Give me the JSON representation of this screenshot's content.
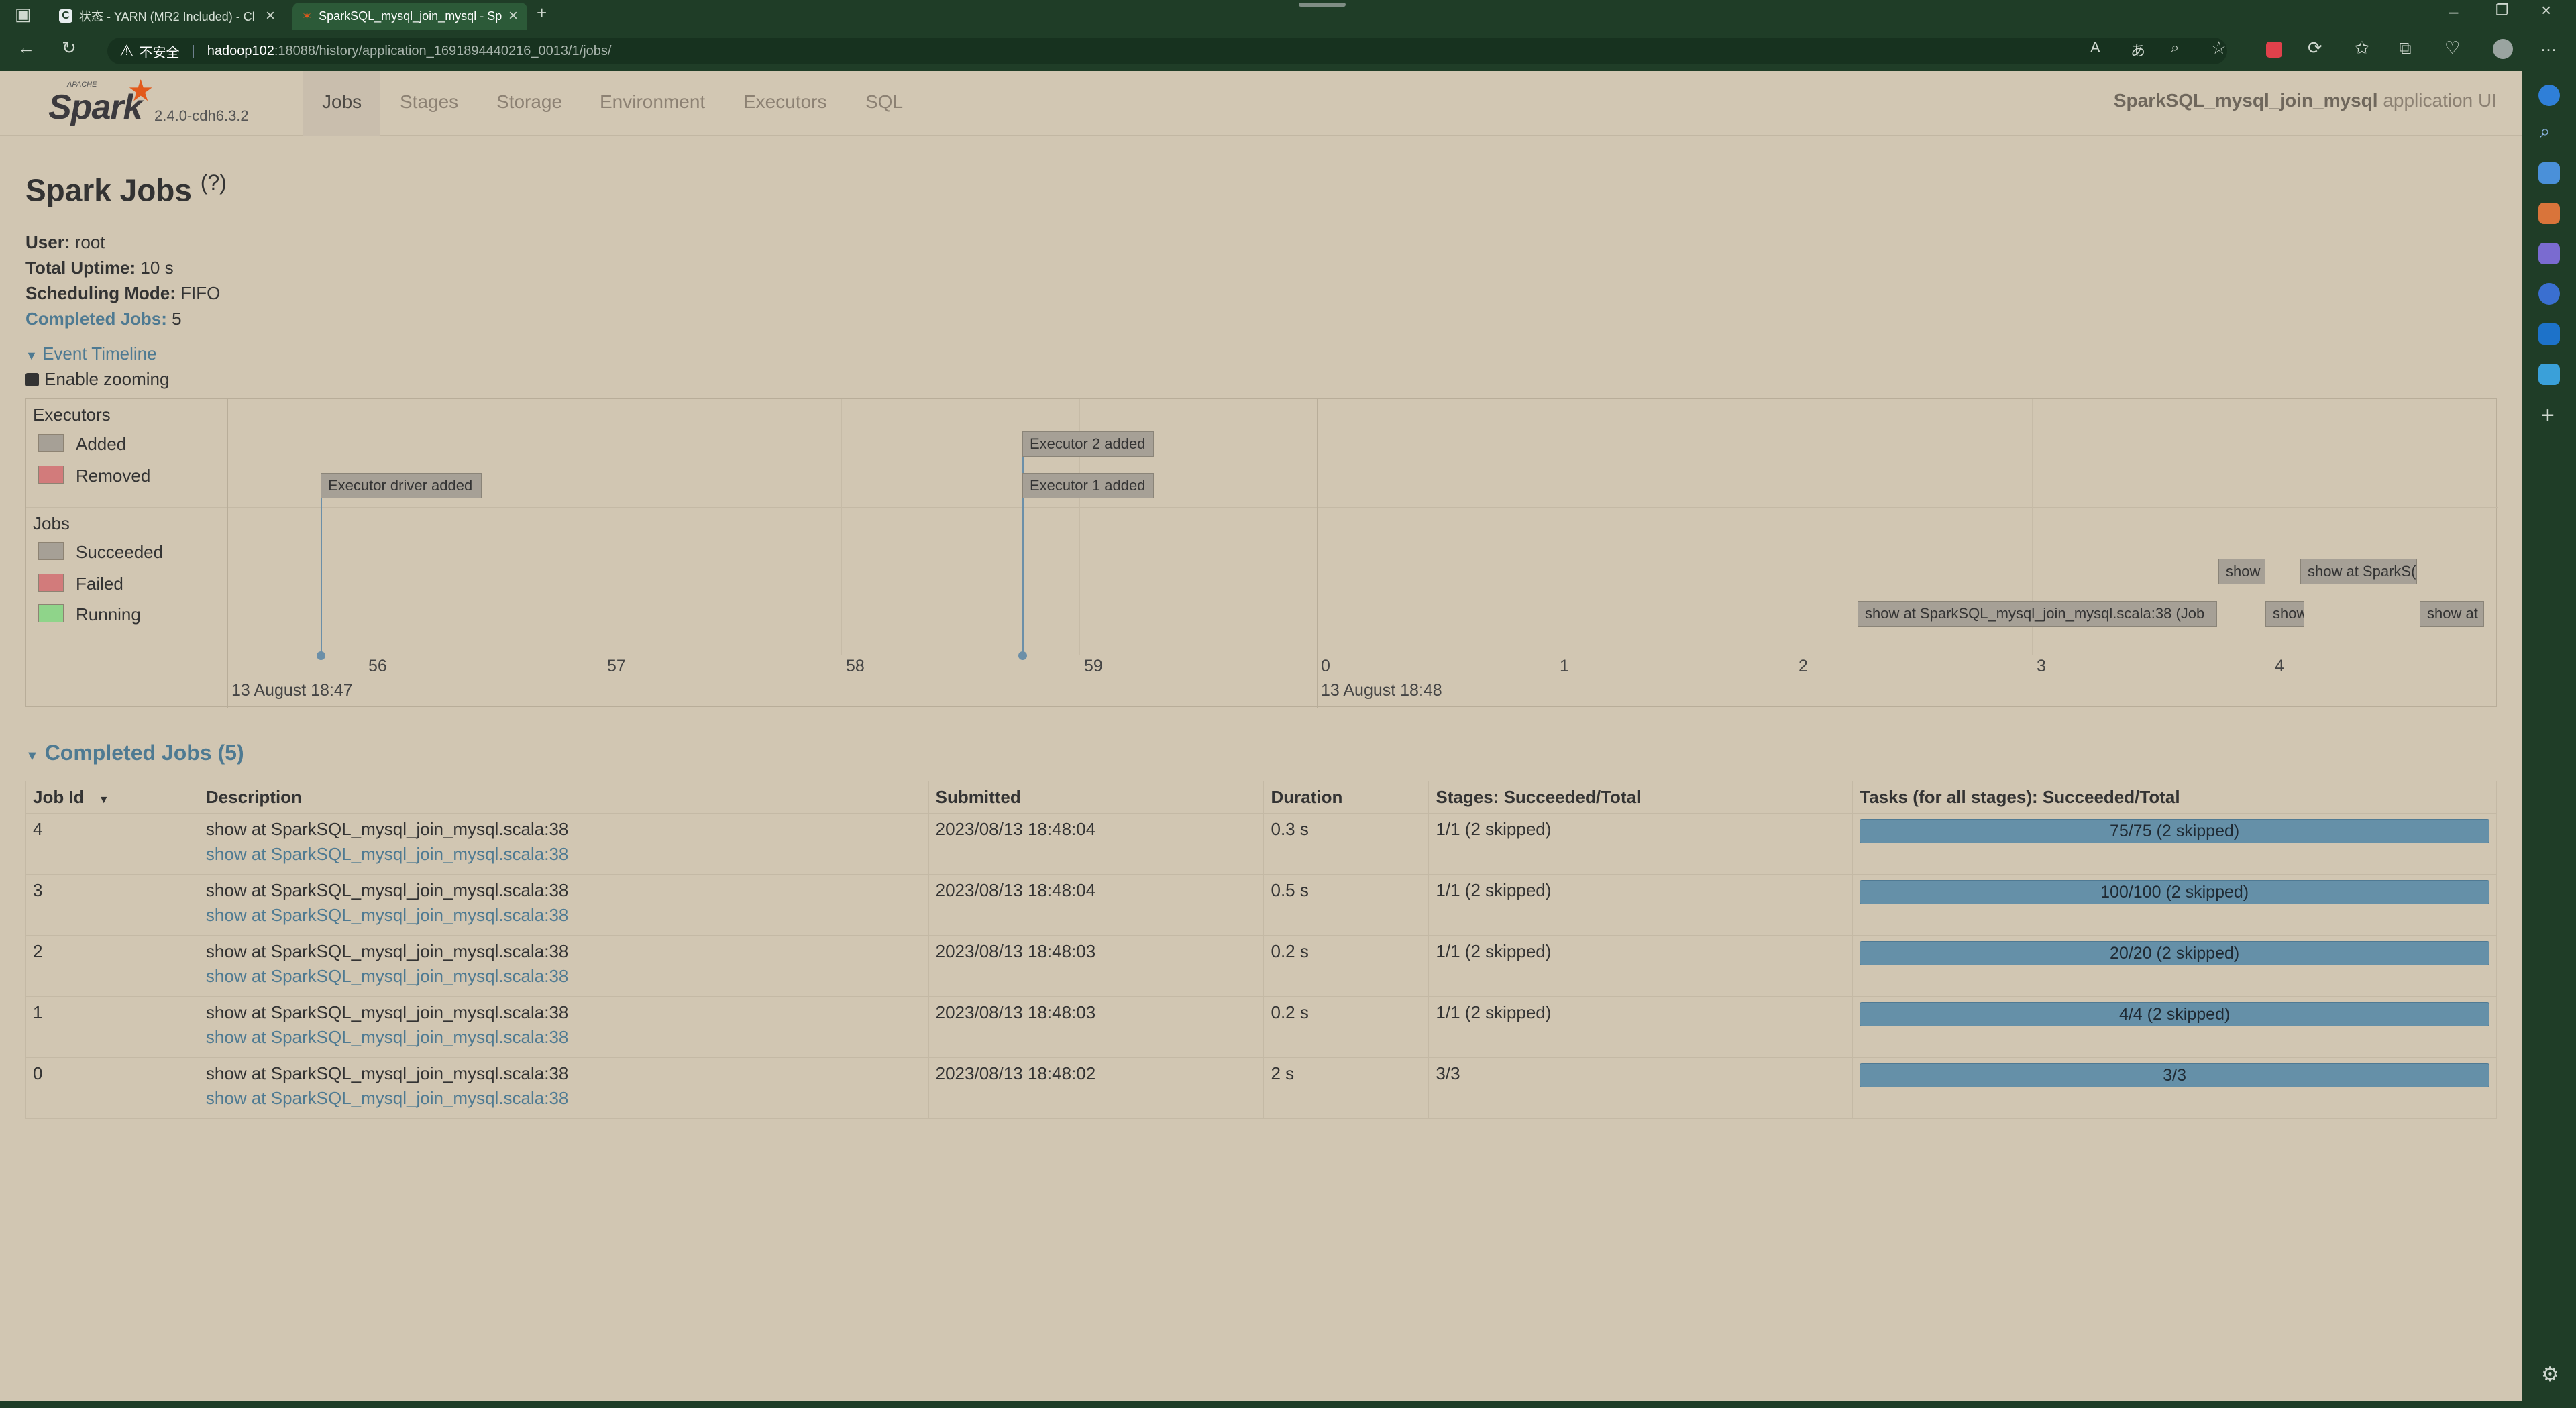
{
  "browser": {
    "tabs": [
      {
        "title": "状态 - YARN (MR2 Included) - Cl",
        "active": false
      },
      {
        "title": "SparkSQL_mysql_join_mysql - Sp",
        "active": true
      }
    ],
    "security_label": "不安全",
    "url_host": "hadoop102",
    "url_path": ":18088/history/application_1691894440216_0013/1/jobs/"
  },
  "spark": {
    "logo_text": "Spark",
    "logo_small": "APACHE",
    "version": "2.4.0-cdh6.3.2",
    "nav": [
      "Jobs",
      "Stages",
      "Storage",
      "Environment",
      "Executors",
      "SQL"
    ],
    "active_nav": "Jobs",
    "app_name": "SparkSQL_mysql_join_mysql",
    "app_suffix": "application UI"
  },
  "page": {
    "title": "Spark Jobs",
    "help": "(?)",
    "user_label": "User:",
    "user": "root",
    "uptime_label": "Total Uptime:",
    "uptime": "10 s",
    "mode_label": "Scheduling Mode:",
    "mode": "FIFO",
    "completed_label": "Completed Jobs:",
    "completed": "5"
  },
  "timeline": {
    "toggle": "Event Timeline",
    "zoom": "Enable zooming",
    "executors_title": "Executors",
    "jobs_title": "Jobs",
    "legend_added": "Added",
    "legend_removed": "Removed",
    "legend_succeeded": "Succeeded",
    "legend_failed": "Failed",
    "legend_running": "Running",
    "events": {
      "driver": "Executor driver added",
      "exec2": "Executor 2 added",
      "exec1": "Executor 1 added"
    },
    "jobs": {
      "j0": "show at SparkSQL_mysql_join_mysql.scala:38 (Job",
      "j1": "show",
      "j2": "show at SparkS(",
      "j3": "show",
      "j4": "show at"
    },
    "ticks": [
      "56",
      "57",
      "58",
      "59",
      "0",
      "1",
      "2",
      "3",
      "4"
    ],
    "date1": "13 August 18:47",
    "date2": "13 August 18:48",
    "colors": {
      "added": "#a6a096",
      "removed": "#d27b7b",
      "succeeded": "#a6a096",
      "failed": "#d27b7b",
      "running": "#8fd48a"
    }
  },
  "completed_section": {
    "title": "Completed Jobs (5)",
    "headers": [
      "Job Id",
      "Description",
      "Submitted",
      "Duration",
      "Stages: Succeeded/Total",
      "Tasks (for all stages): Succeeded/Total"
    ],
    "sort_icon": "▼",
    "rows": [
      {
        "id": "4",
        "desc": "show at SparkSQL_mysql_join_mysql.scala:38",
        "link": "show at SparkSQL_mysql_join_mysql.scala:38",
        "submitted": "2023/08/13 18:48:04",
        "duration": "0.3 s",
        "stages": "1/1 (2 skipped)",
        "tasks": "75/75 (2 skipped)"
      },
      {
        "id": "3",
        "desc": "show at SparkSQL_mysql_join_mysql.scala:38",
        "link": "show at SparkSQL_mysql_join_mysql.scala:38",
        "submitted": "2023/08/13 18:48:04",
        "duration": "0.5 s",
        "stages": "1/1 (2 skipped)",
        "tasks": "100/100 (2 skipped)"
      },
      {
        "id": "2",
        "desc": "show at SparkSQL_mysql_join_mysql.scala:38",
        "link": "show at SparkSQL_mysql_join_mysql.scala:38",
        "submitted": "2023/08/13 18:48:03",
        "duration": "0.2 s",
        "stages": "1/1 (2 skipped)",
        "tasks": "20/20 (2 skipped)"
      },
      {
        "id": "1",
        "desc": "show at SparkSQL_mysql_join_mysql.scala:38",
        "link": "show at SparkSQL_mysql_join_mysql.scala:38",
        "submitted": "2023/08/13 18:48:03",
        "duration": "0.2 s",
        "stages": "1/1 (2 skipped)",
        "tasks": "4/4 (2 skipped)"
      },
      {
        "id": "0",
        "desc": "show at SparkSQL_mysql_join_mysql.scala:38",
        "link": "show at SparkSQL_mysql_join_mysql.scala:38",
        "submitted": "2023/08/13 18:48:02",
        "duration": "2 s",
        "stages": "3/3",
        "tasks": "3/3"
      }
    ]
  }
}
